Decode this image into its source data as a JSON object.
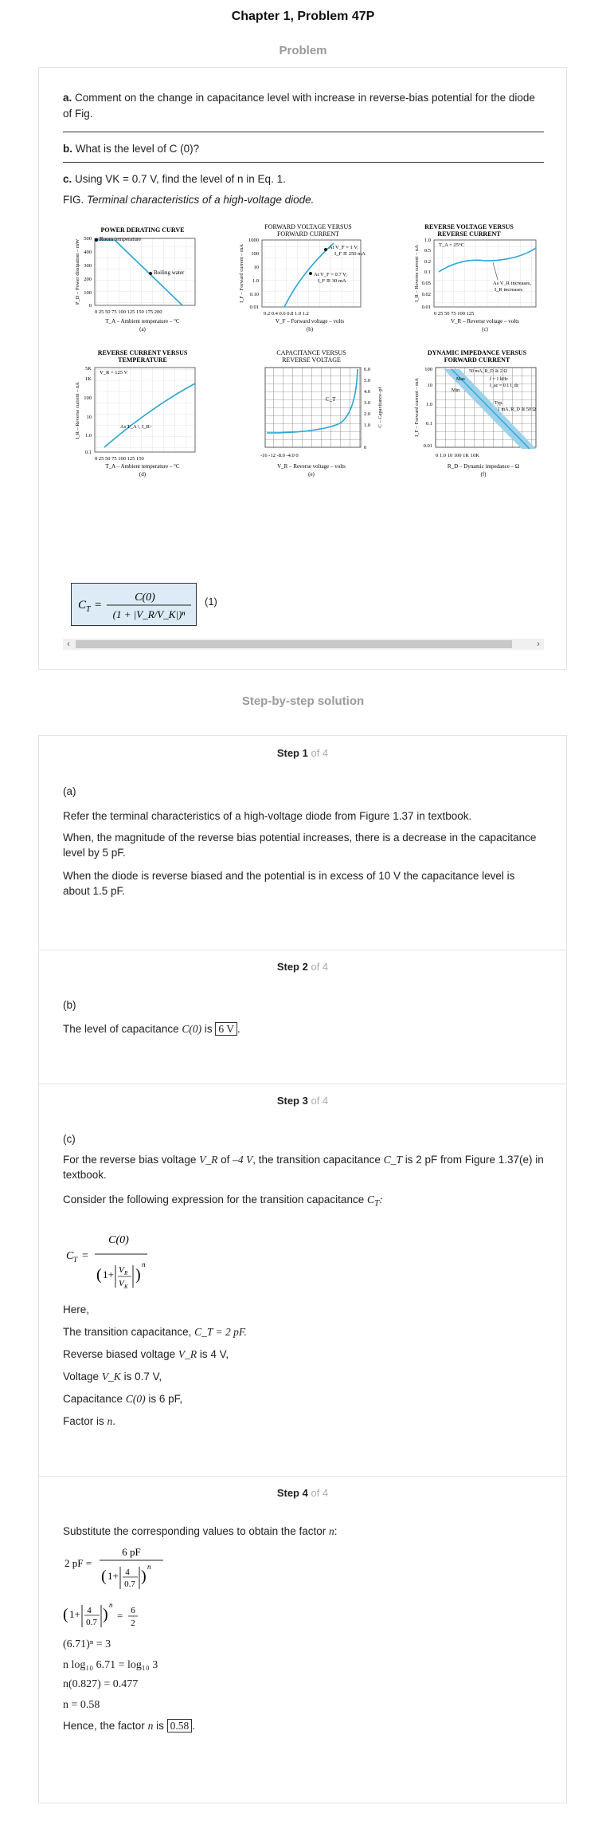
{
  "page": {
    "title": "Chapter 1, Problem 47P",
    "problem_heading": "Problem",
    "solution_heading": "Step-by-step solution"
  },
  "problem": {
    "part_a_label": "a.",
    "part_a_text": "Comment on the change in capacitance level with increase in reverse-bias potential for the diode of Fig.",
    "part_b_label": "b.",
    "part_b_text": "What is the level of C (0)?",
    "part_c_label": "c.",
    "part_c_text": "Using VK = 0.7 V, find the level of n in Eq. 1.",
    "fig_label": "FIG.",
    "fig_caption": "Terminal characteristics of a high-voltage diode.",
    "equation_tag": "(1)"
  },
  "figure": {
    "a": {
      "title1": "POWER DERATING CURVE",
      "ylabel": "P_D – Power dissipation – mW",
      "xlabel": "T_A – Ambient temperature – °C",
      "tag": "(a)",
      "yticks": [
        "500",
        "400",
        "300",
        "200",
        "100",
        "0"
      ],
      "xticks": "0 25 50 75 100 125 150 175 200",
      "ann1": "Room temperature",
      "ann2": "Boiling water"
    },
    "b": {
      "title1": "FORWARD VOLTAGE VERSUS",
      "title2": "FORWARD  CURRENT",
      "ylabel": "I_F – Forward current – mA",
      "xlabel": "V_F – Forward voltage – volts",
      "tag": "(b)",
      "yticks": [
        "1000",
        "100",
        "10",
        "1.0",
        "0.10",
        "0.01"
      ],
      "xticks": "0.2  0.4  0.6  0.8  1.0  1.2",
      "ann1": "At V_F = 1 V,",
      "ann1b": "I_F ≅ 250 mA",
      "ann2": "At V_F = 0.7 V,",
      "ann2b": "I_F ≅ 30 mA"
    },
    "c": {
      "title1": "REVERSE VOLTAGE VERSUS",
      "title2": "REVERSE CURRENT",
      "ylabel": "I_R – Reverse current – nA",
      "xlabel": "V_R – Reverse voltage – volts",
      "tag": "(c)",
      "yticks": [
        "1.0",
        "0.5",
        "0.2",
        "0.1",
        "0.05",
        "0.02",
        "0.01"
      ],
      "xticks": "0   25   50   75   100  125",
      "ann1": "T_A = 25°C",
      "ann2": "As V_R increases,",
      "ann2b": "I_R increases"
    },
    "d": {
      "title1": "REVERSE CURRENT VERSUS",
      "title2": "TEMPERATURE",
      "ylabel": "I_R – Reverse current – nA",
      "xlabel": "T_A – Ambient temperature – °C",
      "tag": "(d)",
      "yticks": [
        "5K",
        "1K",
        "100",
        "10",
        "1.0",
        "0.1"
      ],
      "xticks": "0   25   50   75  100  125  150",
      "ann1": "V_R = 125 V",
      "ann2": "As T_A↑, I_R↑"
    },
    "e": {
      "title1": "CAPACITANCE VERSUS",
      "title2": "REVERSE VOLTAGE",
      "ylabel": "C – Capacitance–pf",
      "xlabel": "V_R – Reverse voltage – volts",
      "tag": "(e)",
      "yticks": [
        "6.0",
        "5.0",
        "4.0",
        "3.0",
        "2.0",
        "1.0",
        "0"
      ],
      "xticks": "-16    -12    -8.0   -4.0     0",
      "ann1": "C_T"
    },
    "f": {
      "title1": "DYNAMIC IMPEDANCE VERSUS",
      "title2": "FORWARD CURRENT",
      "ylabel": "I_F – Forward current – mA",
      "xlabel": "R_D – Dynamic impedance – Ω",
      "tag": "(f)",
      "yticks": [
        "100",
        "10",
        "1.0",
        "0.1",
        "0.01"
      ],
      "xticks": "0   1.0   10   100   1K   10K",
      "ann1": "50 mA, R_D ≅ 2 Ω",
      "ann2": "f = 1 kHz",
      "ann3": "I_ac = 0.1 I_dc",
      "ann4": "Typ.",
      "ann5": "1 mA, R_D ≅ 50 Ω",
      "ann6": "Max",
      "ann7": "Min"
    }
  },
  "steps": [
    {
      "label": "Step 1",
      "of": "of 4",
      "part": "(a)",
      "p1": "Refer the terminal characteristics of a high-voltage diode from Figure 1.37 in textbook.",
      "p2": "When, the magnitude of the reverse bias potential increases, there is a decrease in the capacitance level by 5 pF.",
      "p3": "When the diode is reverse biased and the potential is in excess of 10 V the capacitance level is about 1.5 pF."
    },
    {
      "label": "Step 2",
      "of": "of 4",
      "part": "(b)",
      "p1": "The level of capacitance",
      "p1_math": "C(0)",
      "p1_mid": "is",
      "p1_box": "6 V",
      "p1_end": "."
    },
    {
      "label": "Step 3",
      "of": "of 4",
      "part": "(c)",
      "p1a": "For the reverse bias voltage",
      "p1_vr": "V_R",
      "p1b": "of",
      "p1_val": "–4 V",
      "p1c": ", the transition capacitance",
      "p1_ct": "C_T",
      "p1d": "is 2 pF from Figure 1.37(e) in textbook.",
      "p2": "Consider the following expression for the transition capacitance",
      "here": "Here,",
      "l1": "The transition capacitance,",
      "l1m": "C_T = 2 pF.",
      "l2a": "Reverse biased voltage",
      "l2m": "V_R",
      "l2b": "is 4 V,",
      "l3a": "Voltage",
      "l3m": "V_K",
      "l3b": "is 0.7 V,",
      "l4a": "Capacitance",
      "l4m": "C(0)",
      "l4b": "is 6 pF,",
      "l5a": "Factor is",
      "l5m": "n",
      "l5b": "."
    },
    {
      "label": "Step 4",
      "of": "of 4",
      "p1": "Substitute the corresponding values to obtain the factor",
      "e3": "(6.71)ⁿ = 3",
      "e4": "n log₁₀ 6.71 = log₁₀ 3",
      "e5": "n(0.827) = 0.477",
      "e6": "n = 0.58",
      "final_a": "Hence, the factor",
      "final_m": "n",
      "final_b": "is",
      "final_box": "0.58"
    }
  ]
}
